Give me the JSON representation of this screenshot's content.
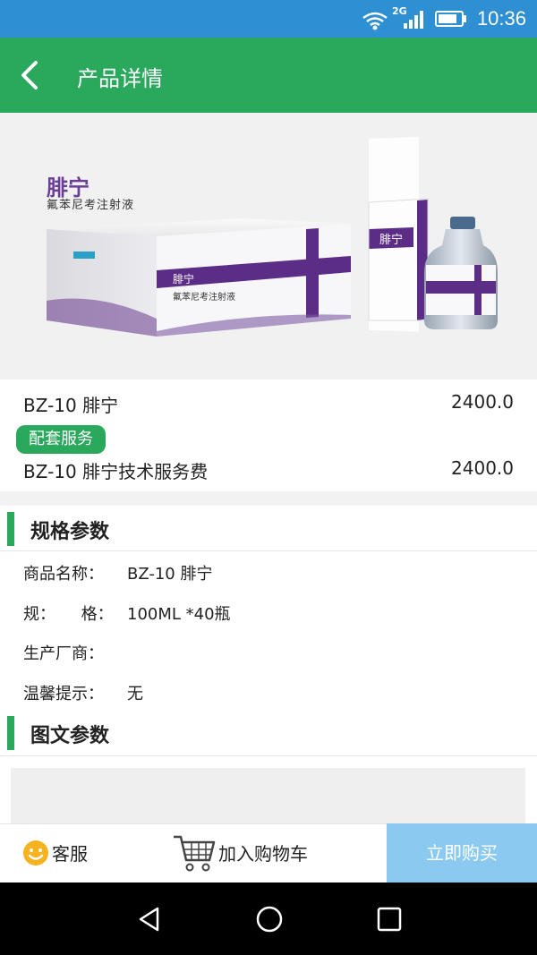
{
  "status_bar": {
    "time": "10:36",
    "network": "2G"
  },
  "header": {
    "title": "产品详情"
  },
  "product_image": {
    "brand_title": "腓宁",
    "brand_subtitle": "氟苯尼考注射液",
    "box_name": "腓宁",
    "box_subtitle": "氟苯尼考注射液"
  },
  "items": [
    {
      "name": "BZ-10 腓宁",
      "price": "2400.0"
    },
    {
      "name": "BZ-10 腓宁技术服务费",
      "price": "2400.0"
    }
  ],
  "service_tag": "配套服务",
  "specs": {
    "heading": "规格参数",
    "rows": [
      {
        "key": "商品名称：",
        "value": "BZ-10 腓宁"
      },
      {
        "key": "规：     格：",
        "value": "100ML *40瓶"
      },
      {
        "key": "生产厂商：",
        "value": ""
      },
      {
        "key": "温馨提示：",
        "value": "无"
      }
    ]
  },
  "graphic": {
    "heading": "图文参数"
  },
  "bottom_bar": {
    "service_label": "客服",
    "cart_label": "加入购物车",
    "buy_label": "立即购买"
  },
  "colors": {
    "status_bar": "#2e8fd2",
    "header": "#2aa85c",
    "accent": "#2aa85c",
    "buy": "#8cc9f0"
  }
}
